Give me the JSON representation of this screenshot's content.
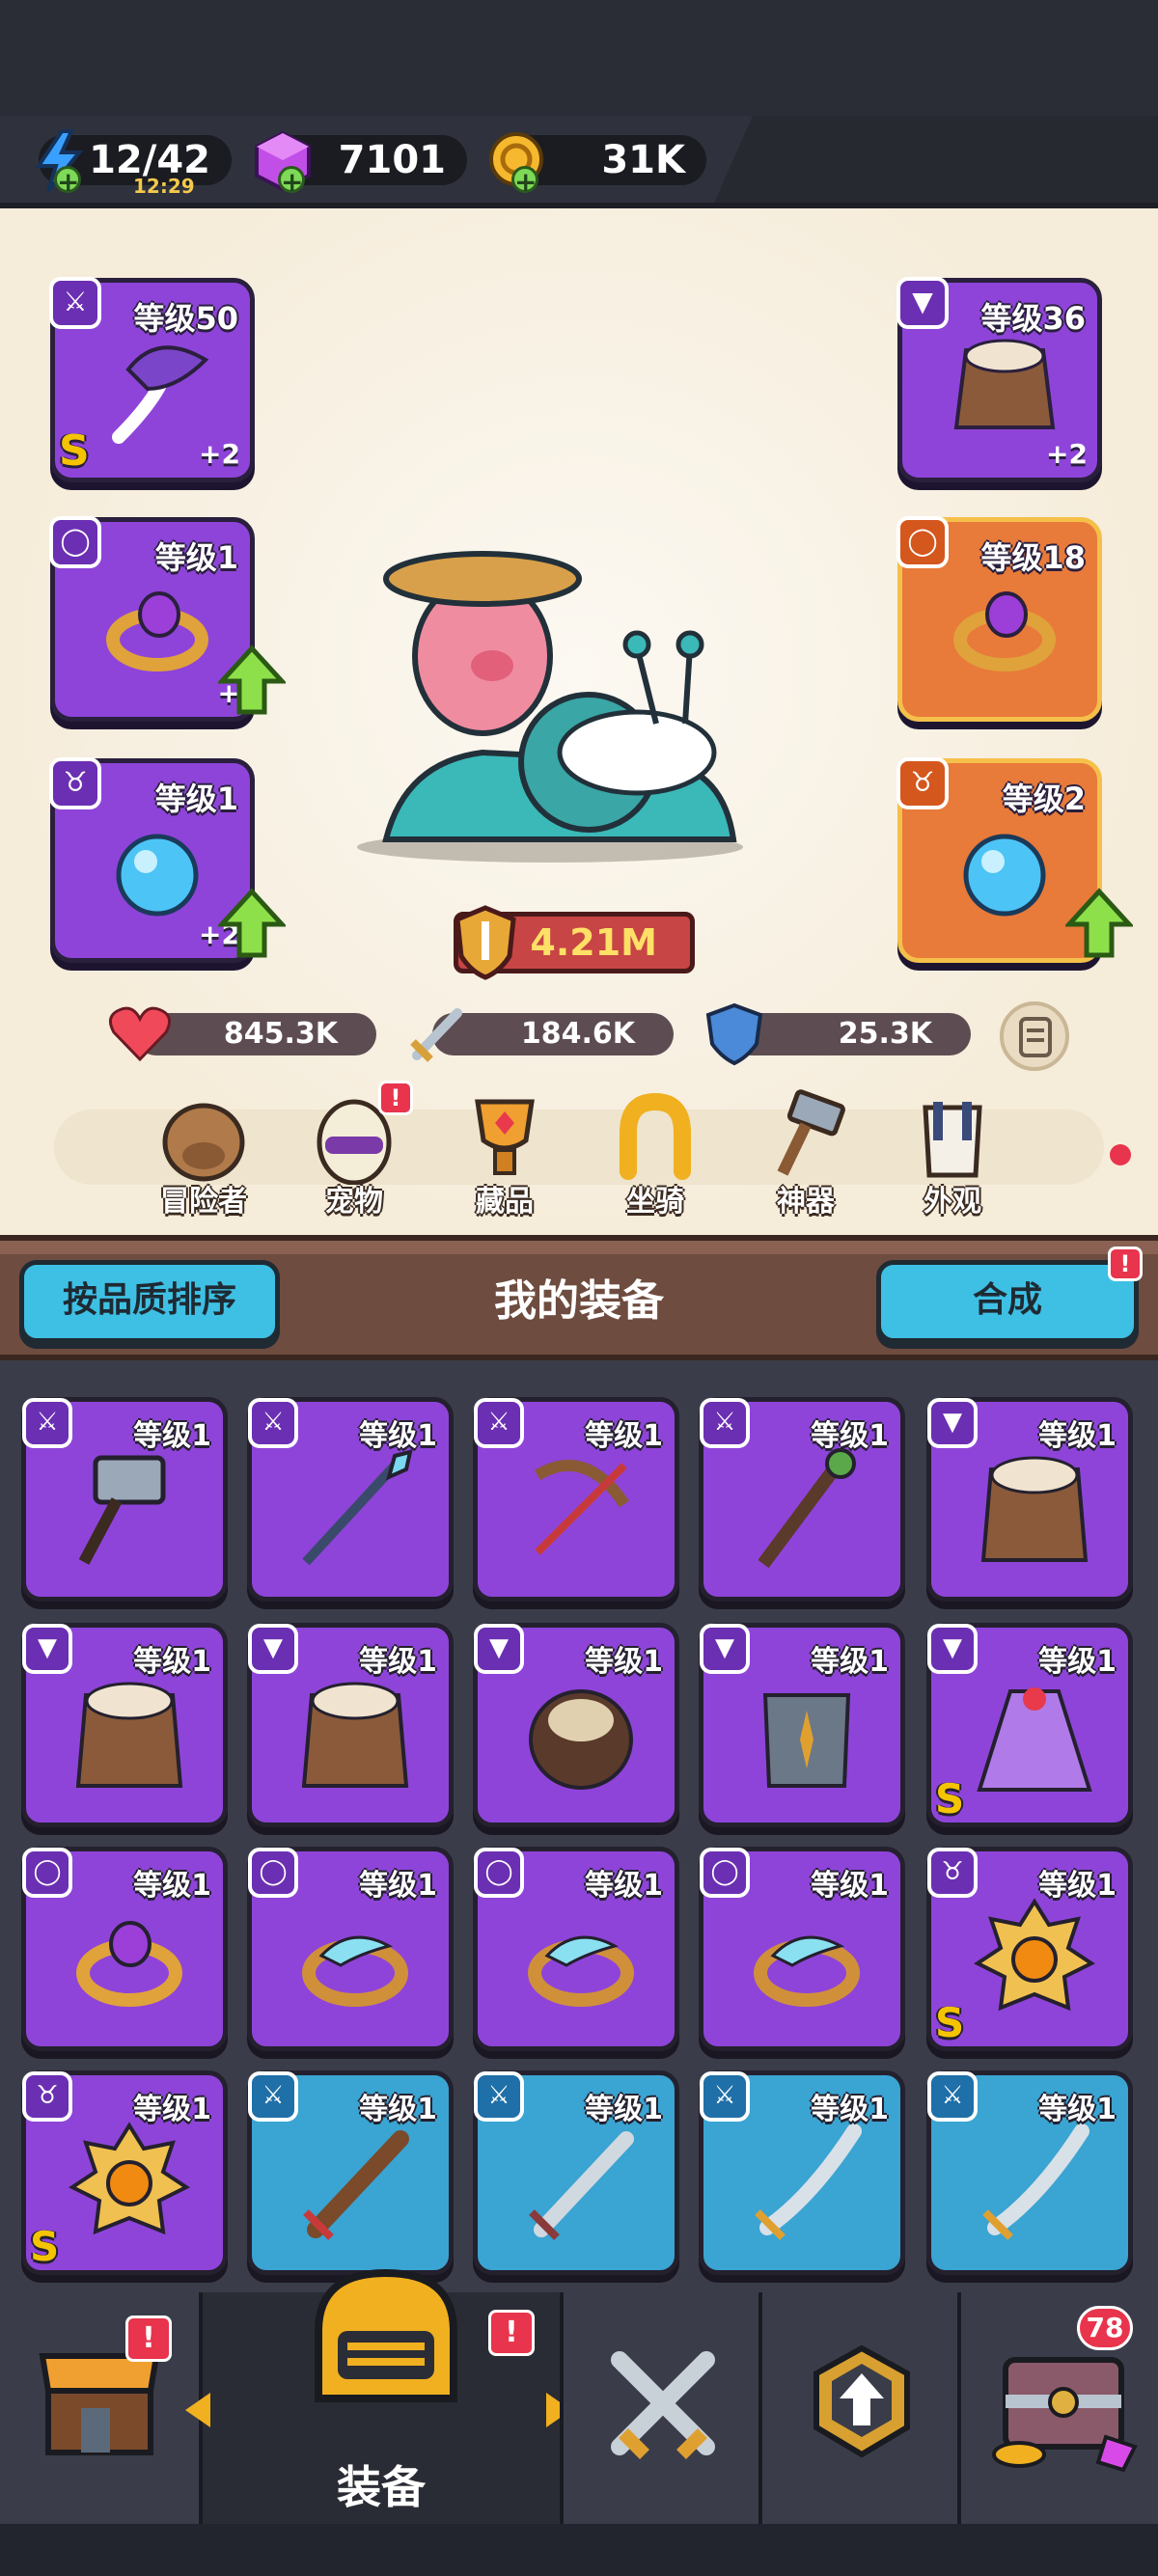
{
  "resources": {
    "energy": {
      "value": "12/42",
      "timer": "12:29"
    },
    "gems": {
      "value": "7101"
    },
    "coins": {
      "value": "31K"
    }
  },
  "equipped": {
    "weapon": {
      "level": "等级50",
      "bonus": "+2",
      "grade": "S"
    },
    "armor": {
      "level": "等级36",
      "bonus": "+2"
    },
    "ring_left": {
      "level": "等级1",
      "bonus": "+"
    },
    "ring_right": {
      "level": "等级18"
    },
    "necklace_left": {
      "level": "等级1",
      "bonus": "+2"
    },
    "necklace_right": {
      "level": "等级2"
    }
  },
  "power": "4.21M",
  "stats": {
    "hp": "845.3K",
    "atk": "184.6K",
    "def": "25.3K"
  },
  "nav": [
    {
      "label": "冒险者"
    },
    {
      "label": "宠物",
      "alert": "!"
    },
    {
      "label": "藏品"
    },
    {
      "label": "坐骑"
    },
    {
      "label": "神器"
    },
    {
      "label": "外观"
    }
  ],
  "equip_bar": {
    "sort_label": "按品质排序",
    "title": "我的装备",
    "merge_label": "合成",
    "merge_alert": "!"
  },
  "inventory": [
    {
      "level": "等级1",
      "type": "weapon",
      "rarity": "purple",
      "item": "hammer"
    },
    {
      "level": "等级1",
      "type": "weapon",
      "rarity": "purple",
      "item": "spear"
    },
    {
      "level": "等级1",
      "type": "weapon",
      "rarity": "purple",
      "item": "bow"
    },
    {
      "level": "等级1",
      "type": "weapon",
      "rarity": "purple",
      "item": "staff"
    },
    {
      "level": "等级1",
      "type": "armor",
      "rarity": "purple",
      "item": "leather-vest"
    },
    {
      "level": "等级1",
      "type": "armor",
      "rarity": "purple",
      "item": "leather-vest"
    },
    {
      "level": "等级1",
      "type": "armor",
      "rarity": "purple",
      "item": "leather-vest"
    },
    {
      "level": "等级1",
      "type": "armor",
      "rarity": "purple",
      "item": "fur-armor"
    },
    {
      "level": "等级1",
      "type": "armor",
      "rarity": "purple",
      "item": "plate-armor"
    },
    {
      "level": "等级1",
      "type": "armor",
      "rarity": "purple",
      "item": "cape",
      "grade": "S"
    },
    {
      "level": "等级1",
      "type": "ring",
      "rarity": "purple",
      "item": "gem-ring"
    },
    {
      "level": "等级1",
      "type": "ring",
      "rarity": "purple",
      "item": "wing-ring"
    },
    {
      "level": "等级1",
      "type": "ring",
      "rarity": "purple",
      "item": "wing-ring"
    },
    {
      "level": "等级1",
      "type": "ring",
      "rarity": "purple",
      "item": "wing-ring"
    },
    {
      "level": "等级1",
      "type": "necklace",
      "rarity": "purple",
      "item": "sun-amulet",
      "grade": "S"
    },
    {
      "level": "等级1",
      "type": "necklace",
      "rarity": "purple",
      "item": "sun-amulet",
      "grade": "S"
    },
    {
      "level": "等级1",
      "type": "weapon",
      "rarity": "blue",
      "item": "wood-sword"
    },
    {
      "level": "等级1",
      "type": "weapon",
      "rarity": "blue",
      "item": "steel-sword"
    },
    {
      "level": "等级1",
      "type": "weapon",
      "rarity": "blue",
      "item": "scimitar"
    },
    {
      "level": "等级1",
      "type": "weapon",
      "rarity": "blue",
      "item": "scimitar"
    }
  ],
  "tabs": {
    "shop_alert": "!",
    "equip_label": "装备",
    "equip_alert": "!",
    "chest_count": "78"
  },
  "colors": {
    "purple_card": "#8e44d9",
    "blue_card": "#3aa4d2",
    "orange_card": "#e87a3a",
    "accent_button": "#3ec0e4",
    "alert_red": "#e8344c"
  }
}
